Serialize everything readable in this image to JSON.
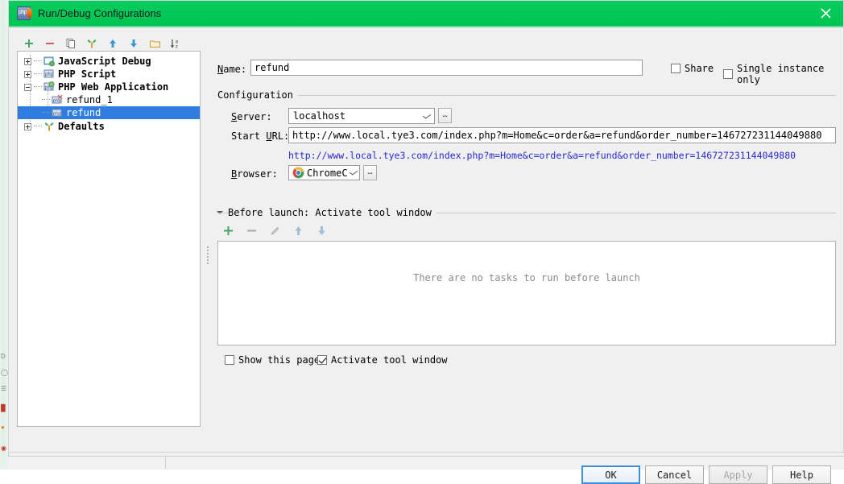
{
  "window": {
    "title": "Run/Debug Configurations",
    "app_icon": "php-storm-icon",
    "close_label": "✕",
    "titlebar_color": "#00c452"
  },
  "left_toolbar": {
    "buttons": [
      {
        "name": "add-configuration-button",
        "icon": "plus-icon",
        "tooltip": "Add New Configuration"
      },
      {
        "name": "remove-configuration-button",
        "icon": "minus-icon",
        "tooltip": "Remove Configuration"
      },
      {
        "name": "copy-configuration-button",
        "icon": "copy-icon",
        "tooltip": "Copy Configuration"
      },
      {
        "name": "save-configuration-button",
        "icon": "wrench-icon",
        "tooltip": "Save Configuration"
      },
      {
        "name": "move-up-button",
        "icon": "arrow-up-icon",
        "tooltip": "Move Up"
      },
      {
        "name": "move-down-button",
        "icon": "arrow-down-icon",
        "tooltip": "Move Down"
      },
      {
        "name": "create-folder-button",
        "icon": "folder-icon",
        "tooltip": "Create New Folder"
      },
      {
        "name": "sort-configurations-button",
        "icon": "sort-alpha-icon",
        "tooltip": "Sort Configurations"
      }
    ]
  },
  "tree": {
    "items": [
      {
        "label": "JavaScript Debug",
        "level": 0,
        "expandable": true,
        "expanded": false,
        "selected": false,
        "icon": "javascript-debug-icon"
      },
      {
        "label": "PHP Script",
        "level": 0,
        "expandable": true,
        "expanded": false,
        "selected": false,
        "icon": "php-script-icon"
      },
      {
        "label": "PHP Web Application",
        "level": 0,
        "expandable": true,
        "expanded": true,
        "selected": false,
        "icon": "php-web-app-icon"
      },
      {
        "label": "refund_1",
        "level": 1,
        "expandable": false,
        "expanded": false,
        "selected": false,
        "icon": "php-config-icon"
      },
      {
        "label": "refund",
        "level": 1,
        "expandable": false,
        "expanded": false,
        "selected": true,
        "icon": "php-config-icon"
      },
      {
        "label": "Defaults",
        "level": 0,
        "expandable": true,
        "expanded": false,
        "selected": false,
        "icon": "defaults-wrench-icon"
      }
    ]
  },
  "form": {
    "name_label": "Name:",
    "name_label_mnemonic": "N",
    "name_value": "refund",
    "share": {
      "label": "Share",
      "mnemonic": "S",
      "checked": false
    },
    "single_instance": {
      "label": "Single instance only",
      "mnemonic": "i",
      "checked": false
    }
  },
  "configuration": {
    "legend": "Configuration",
    "server": {
      "label": "Server:",
      "mnemonic": "S",
      "value": "localhost",
      "ellipsis_label": "…"
    },
    "start_url": {
      "label": "Start URL:",
      "mnemonic": "U",
      "value": "http://www.local.tye3.com/index.php?m=Home&c=order&a=refund&order_number=146727231144049880",
      "hint_link": "http://www.local.tye3.com/index.php?m=Home&c=order&a=refund&order_number=146727231144049880",
      "hint_color": "#2727cf"
    },
    "browser": {
      "label": "Browser:",
      "mnemonic": "B",
      "value": "ChromeC",
      "icon": "chrome-icon",
      "ellipsis_label": "…"
    }
  },
  "before_launch": {
    "legend": "Before launch: Activate tool window",
    "legend_mnemonic": "B",
    "expanded": true,
    "toolbar": [
      {
        "name": "add-task-button",
        "icon": "plus-icon",
        "enabled": true
      },
      {
        "name": "remove-task-button",
        "icon": "minus-icon",
        "enabled": false
      },
      {
        "name": "edit-task-button",
        "icon": "pencil-icon",
        "enabled": false
      },
      {
        "name": "task-move-up-button",
        "icon": "arrow-up-icon",
        "enabled": true
      },
      {
        "name": "task-move-down-button",
        "icon": "arrow-down-icon",
        "enabled": true
      }
    ],
    "empty_text": "There are no tasks to run before launch",
    "show_this_page": {
      "label": "Show this page",
      "checked": false
    },
    "activate_tool_window": {
      "label": "Activate tool window",
      "checked": true
    }
  },
  "buttons": {
    "ok": "OK",
    "cancel": "Cancel",
    "apply": "Apply",
    "apply_enabled": false,
    "help": "Help"
  }
}
